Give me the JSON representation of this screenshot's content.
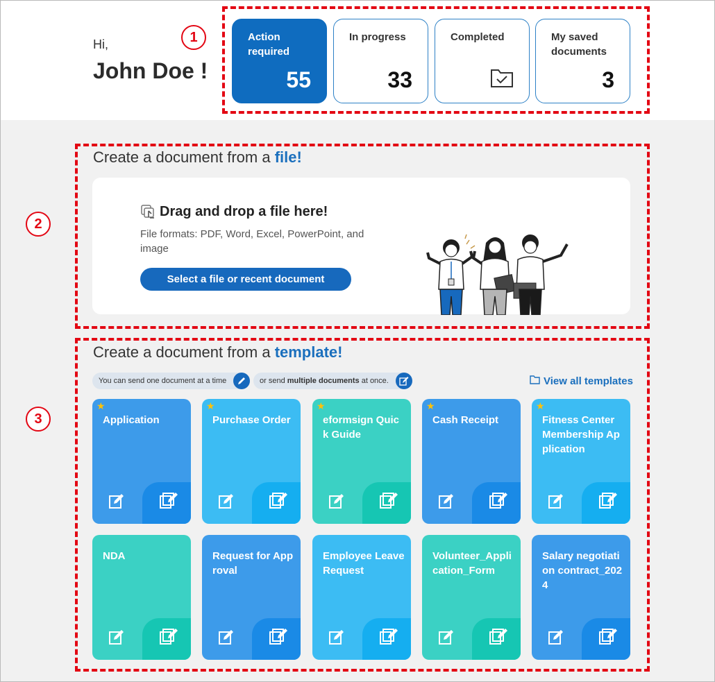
{
  "greeting": {
    "hi": "Hi,",
    "name": "John Doe !"
  },
  "stats": [
    {
      "label": "Action required",
      "value": "55",
      "active": true
    },
    {
      "label": "In progress",
      "value": "33"
    },
    {
      "label": "Completed",
      "icon": "folder-check-icon"
    },
    {
      "label": "My saved documents",
      "value": "3"
    }
  ],
  "markers": [
    "1",
    "2",
    "3"
  ],
  "file_section": {
    "title_prefix": "Create a document from a ",
    "title_highlight": "file!",
    "drop_title": "Drag and drop a file here!",
    "formats": "File formats: PDF, Word, Excel, PowerPoint, and image",
    "button": "Select a file or recent document"
  },
  "template_section": {
    "title_prefix": "Create a document from a ",
    "title_highlight": "template!",
    "pill1": "You can send one document at a time",
    "pill2_prefix": "or send ",
    "pill2_bold": "multiple documents",
    "pill2_suffix": " at once.",
    "view_all": "View all templates"
  },
  "templates": [
    {
      "name": "Application",
      "starred": true,
      "color": "blue"
    },
    {
      "name": "Purchase Order",
      "starred": true,
      "color": "sky"
    },
    {
      "name": "eformsign Quick Guide",
      "starred": true,
      "color": "teal"
    },
    {
      "name": "Cash Receipt",
      "starred": true,
      "color": "blue"
    },
    {
      "name": "Fitness Center Membership Ap plication",
      "starred": true,
      "color": "sky"
    },
    {
      "name": "NDA",
      "starred": false,
      "color": "teal"
    },
    {
      "name": "Request for App roval",
      "starred": false,
      "color": "blue"
    },
    {
      "name": "Employee Leave Request",
      "starred": false,
      "color": "sky"
    },
    {
      "name": "Volunteer_Appli cation_Form",
      "starred": false,
      "color": "teal"
    },
    {
      "name": "Salary negotiati on contract_202 4",
      "starred": false,
      "color": "blue"
    }
  ],
  "colors": {
    "primary": "#1769bd",
    "highlight": "#e30613",
    "star": "#ffc107"
  }
}
